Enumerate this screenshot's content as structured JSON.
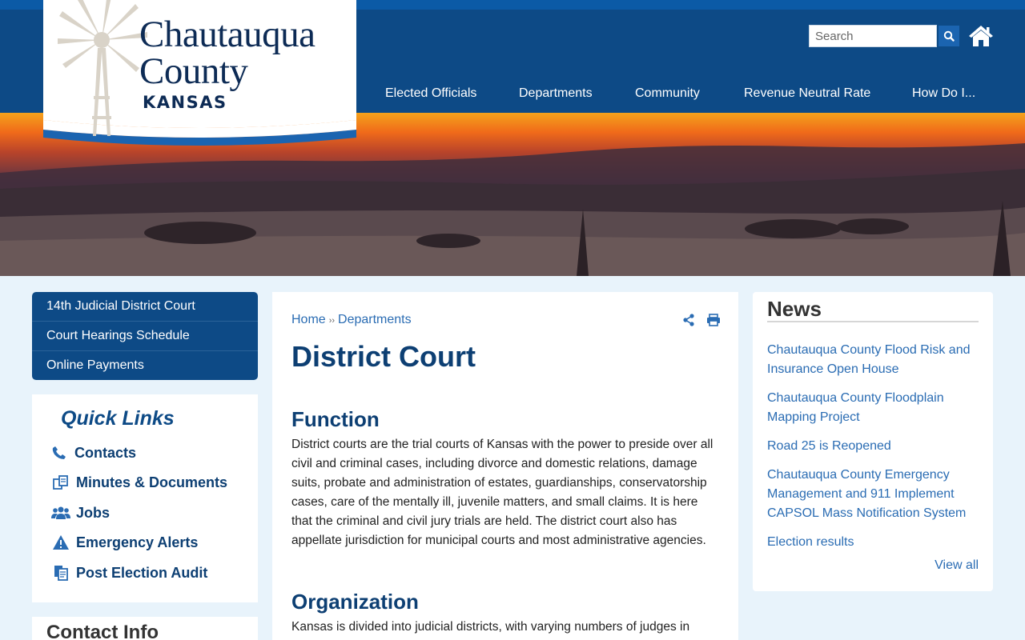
{
  "header": {
    "logo_line1": "Chautauqua",
    "logo_line2": "County",
    "logo_state": "KANSAS",
    "search_placeholder": "Search",
    "nav": [
      {
        "label": "Elected Officials"
      },
      {
        "label": "Departments"
      },
      {
        "label": "Community"
      },
      {
        "label": "Revenue Neutral Rate"
      },
      {
        "label": "How Do I..."
      }
    ]
  },
  "left_nav": [
    {
      "label": "14th Judicial District Court"
    },
    {
      "label": "Court Hearings Schedule"
    },
    {
      "label": "Online Payments"
    }
  ],
  "quick_links": {
    "title": "Quick Links",
    "items": [
      {
        "label": "Contacts",
        "icon": "phone-icon"
      },
      {
        "label": "Minutes & Documents",
        "icon": "documents-icon"
      },
      {
        "label": "Jobs",
        "icon": "users-icon"
      },
      {
        "label": "Emergency Alerts",
        "icon": "warning-icon"
      },
      {
        "label": "Post Election Audit",
        "icon": "clipboard-icon"
      }
    ]
  },
  "contact_info": {
    "title": "Contact Info"
  },
  "main": {
    "breadcrumb": {
      "home": "Home",
      "separator": "››",
      "current": "Departments"
    },
    "title": "District Court",
    "sections": [
      {
        "heading": "Function",
        "text": "District courts are the trial courts of Kansas with the power to preside over all civil and criminal cases, including divorce and domestic relations, damage suits, probate and administration of estates, guardianships, conservatorship cases, care of the mentally ill, juvenile matters, and small claims. It is here that the criminal and civil jury trials are held. The district court also has appellate jurisdiction for municipal courts and most administrative agencies."
      },
      {
        "heading": "Organization",
        "text": "Kansas is divided into judicial districts, with varying numbers of judges in"
      }
    ]
  },
  "news": {
    "title": "News",
    "items": [
      {
        "label": "Chautauqua County Flood Risk and Insurance Open House"
      },
      {
        "label": "Chautauqua County Floodplain Mapping Project"
      },
      {
        "label": "Road 25 is Reopened"
      },
      {
        "label": "Chautauqua County Emergency Management and 911 Implement CAPSOL Mass Notification System"
      },
      {
        "label": "Election results"
      }
    ],
    "view_all": "View all"
  },
  "colors": {
    "header_blue": "#0d4a86",
    "link_blue": "#2a6cb3",
    "heading_blue": "#0d3f73"
  }
}
